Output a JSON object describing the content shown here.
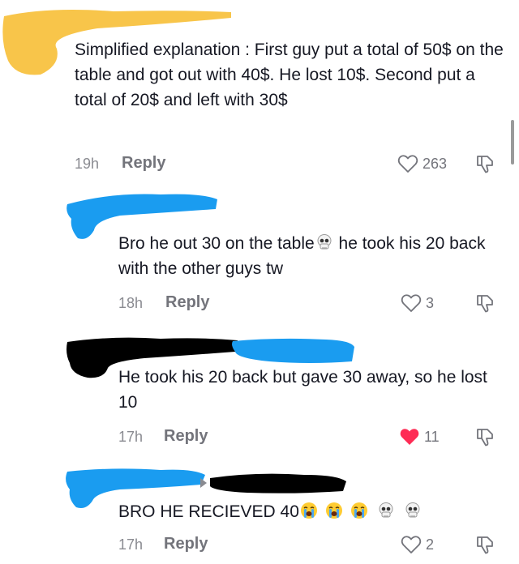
{
  "comments": [
    {
      "text": "Simplified explanation : First guy put a total of 50$ on the table and got out with 40$. He lost 10$. Second put a total of 20$ and left with 30$",
      "time": "19h",
      "reply_label": "Reply",
      "likes": "263",
      "liked": false
    },
    {
      "text_before": "Bro he out 30 on the table",
      "emoji_1": "skull-emoji",
      "text_after": " he took his 20 back with the other guys tw",
      "time": "18h",
      "reply_label": "Reply",
      "likes": "3",
      "liked": false
    },
    {
      "text": "He took his 20 back but gave 30 away, so he lost 10",
      "time": "17h",
      "reply_label": "Reply",
      "likes": "11",
      "liked": true
    },
    {
      "text": "BRO HE RECIEVED 40",
      "emojis": [
        "loudly-crying-emoji",
        "loudly-crying-emoji",
        "loudly-crying-emoji",
        "skull-emoji",
        "skull-emoji"
      ],
      "time": "17h",
      "reply_label": "Reply",
      "likes": "2",
      "liked": false
    }
  ],
  "colors": {
    "text": "#161823",
    "meta": "#8a8b91",
    "liked_heart": "#fe2c55",
    "scribble_yellow": "#f8c54a",
    "scribble_blue": "#1a9cf0",
    "scribble_black": "#000000"
  }
}
